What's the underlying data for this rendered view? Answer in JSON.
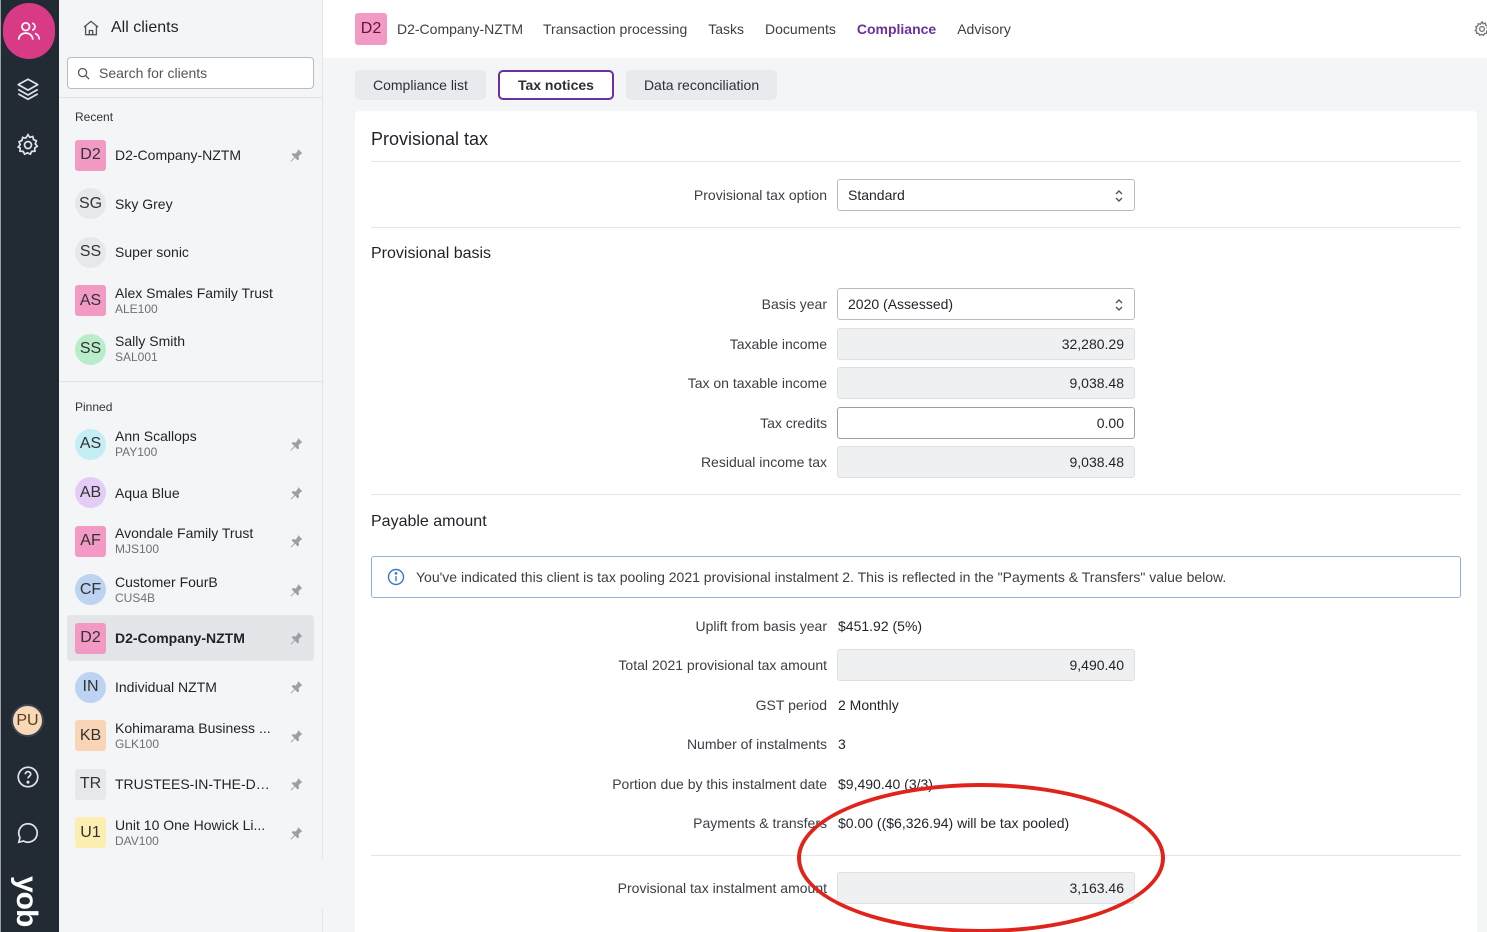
{
  "rail": {
    "avatar_initials": "PU",
    "logo_text": "yob"
  },
  "sidebar": {
    "header": "All clients",
    "search_placeholder": "Search for clients",
    "recent_label": "Recent",
    "pinned_label": "Pinned",
    "recent": [
      {
        "initials": "D2",
        "name": "D2-Company-NZTM",
        "code": "",
        "color": "#f29ac4",
        "square": true,
        "pinned": true
      },
      {
        "initials": "SG",
        "name": "Sky Grey",
        "code": "",
        "color": "#e6e8eb",
        "square": false,
        "pinned": false
      },
      {
        "initials": "SS",
        "name": "Super sonic",
        "code": "",
        "color": "#e6e8eb",
        "square": false,
        "pinned": false
      },
      {
        "initials": "AS",
        "name": "Alex Smales Family Trust",
        "code": "ALE100",
        "color": "#f29ac4",
        "square": true,
        "pinned": false
      },
      {
        "initials": "SS",
        "name": "Sally Smith",
        "code": "SAL001",
        "color": "#b9ecc9",
        "square": false,
        "pinned": false
      }
    ],
    "pinned": [
      {
        "initials": "AS",
        "name": "Ann Scallops",
        "code": "PAY100",
        "color": "#c4eef3",
        "square": false
      },
      {
        "initials": "AB",
        "name": "Aqua Blue",
        "code": "",
        "color": "#e3cdf6",
        "square": false
      },
      {
        "initials": "AF",
        "name": "Avondale Family Trust",
        "code": "MJS100",
        "color": "#f29ac4",
        "square": true
      },
      {
        "initials": "CF",
        "name": "Customer FourB",
        "code": "CUS4B",
        "color": "#bcd3f2",
        "square": false
      },
      {
        "initials": "D2",
        "name": "D2-Company-NZTM",
        "code": "",
        "color": "#f29ac4",
        "square": true
      },
      {
        "initials": "IN",
        "name": "Individual NZTM",
        "code": "",
        "color": "#bcd3f2",
        "square": false
      },
      {
        "initials": "KB",
        "name": "Kohimarama Business ...",
        "code": "GLK100",
        "color": "#f9d5b5",
        "square": true
      },
      {
        "initials": "TR",
        "name": "TRUSTEES-IN-THE-DH...",
        "code": "",
        "color": "#e6e8eb",
        "square": true
      },
      {
        "initials": "U1",
        "name": "Unit 10 One Howick Li...",
        "code": "DAV100",
        "color": "#fbeeb0",
        "square": true
      }
    ]
  },
  "topbar": {
    "company_initials": "D2",
    "company_name": "D2-Company-NZTM",
    "nav": [
      "Transaction processing",
      "Tasks",
      "Documents",
      "Compliance",
      "Advisory"
    ]
  },
  "subtabs": [
    "Compliance list",
    "Tax notices",
    "Data reconciliation"
  ],
  "provisional": {
    "title": "Provisional tax",
    "option_label": "Provisional tax option",
    "option_value": "Standard",
    "basis_title": "Provisional basis",
    "basis_year_label": "Basis year",
    "basis_year_value": "2020 (Assessed)",
    "taxable_income_label": "Taxable income",
    "taxable_income_value": "32,280.29",
    "tax_on_income_label": "Tax on taxable income",
    "tax_on_income_value": "9,038.48",
    "tax_credits_label": "Tax credits",
    "tax_credits_value": "0.00",
    "residual_label": "Residual income tax",
    "residual_value": "9,038.48",
    "payable_title": "Payable amount",
    "info_text": "You've indicated this client is tax pooling 2021 provisional instalment 2. This is reflected in the \"Payments & Transfers\" value below.",
    "uplift_label": "Uplift from basis year",
    "uplift_value": "$451.92 (5%)",
    "total_label": "Total 2021 provisional tax amount",
    "total_value": "9,490.40",
    "gst_label": "GST period",
    "gst_value": "2 Monthly",
    "instalments_label": "Number of instalments",
    "instalments_value": "3",
    "portion_label": "Portion due by this instalment date",
    "portion_value": "$9,490.40 (3/3)",
    "payments_label": "Payments & transfers",
    "payments_value": "$0.00 (($6,326.94) will be tax pooled)",
    "instalment_amount_label": "Provisional tax instalment amount",
    "instalment_amount_value": "3,163.46"
  }
}
